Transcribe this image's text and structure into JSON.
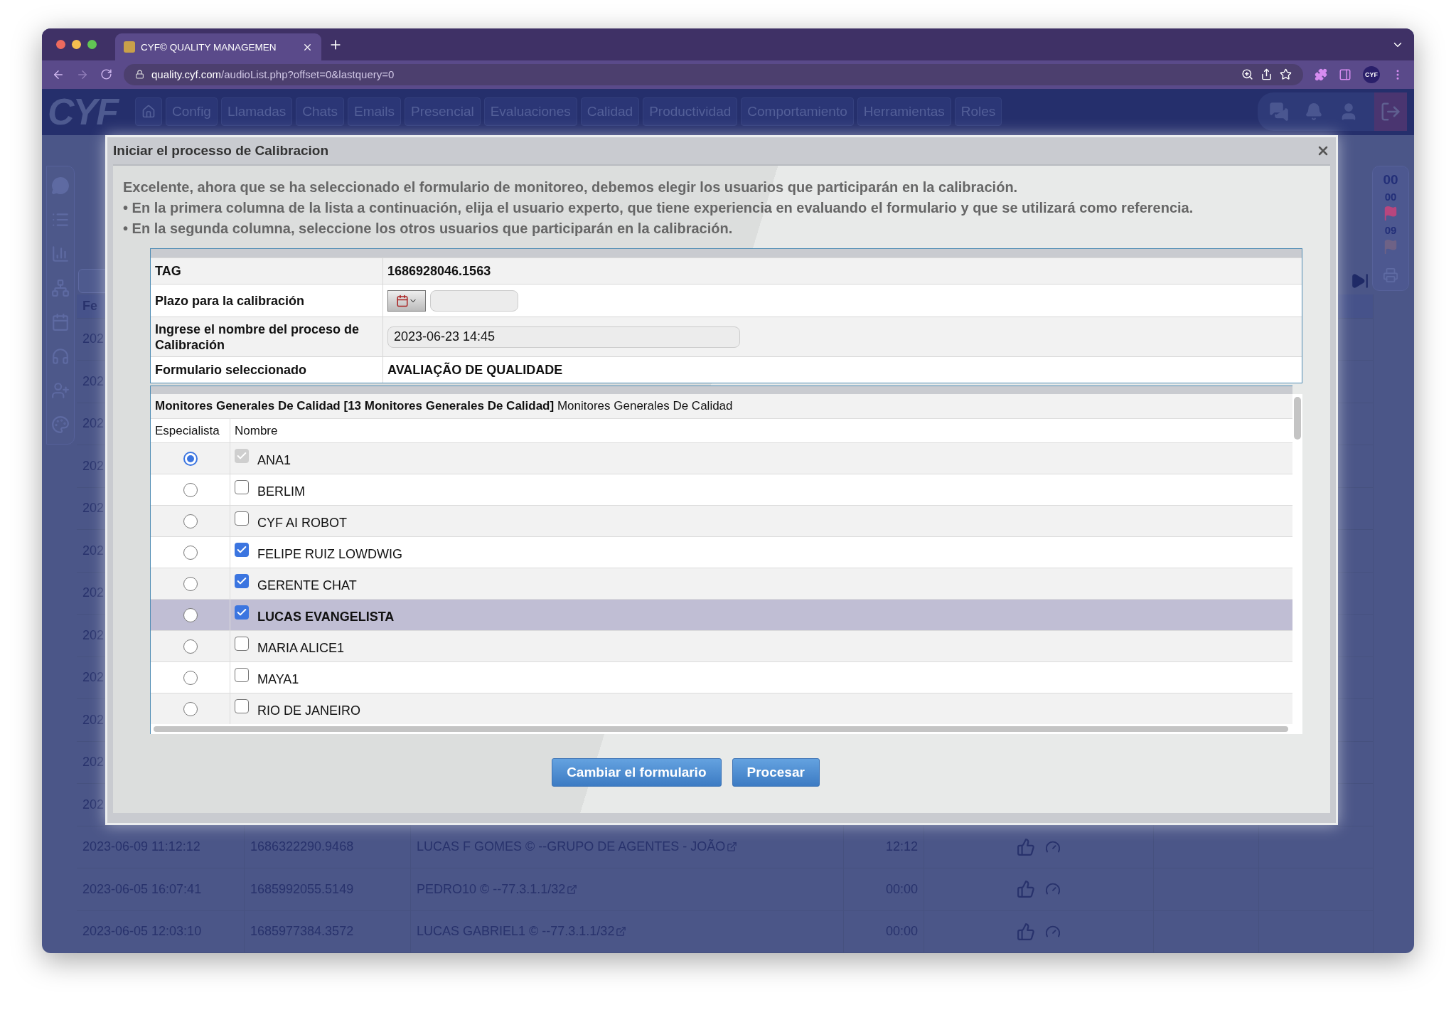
{
  "browser": {
    "tab_title": "CYF© QUALITY MANAGEMEN",
    "address": "**quality.cyf.com**/audioList.php?offset=0&lastquery=0",
    "profile": "CYF"
  },
  "nav": {
    "logo": "CYF",
    "items": [
      "Config",
      "Llamadas",
      "Chats",
      "Emails",
      "Presencial",
      "Evaluaciones",
      "Calidad",
      "Productividad",
      "Comportamiento",
      "Herramientas",
      "Roles"
    ]
  },
  "right_panel": [
    {
      "kind": "count",
      "text": "00"
    },
    {
      "kind": "count",
      "text": "00"
    },
    {
      "kind": "flag",
      "color": "#b8467e"
    },
    {
      "kind": "count",
      "text": "09"
    },
    {
      "kind": "flag",
      "color": "#6e6286"
    }
  ],
  "table": {
    "header": "Fe",
    "rows": [
      {
        "kind": "covered",
        "date": "202"
      },
      {
        "kind": "covered",
        "date": "202"
      },
      {
        "kind": "covered",
        "date": "202"
      },
      {
        "kind": "covered",
        "date": "202"
      },
      {
        "kind": "covered",
        "date": "202"
      },
      {
        "kind": "covered",
        "date": "202"
      },
      {
        "kind": "covered",
        "date": "202"
      },
      {
        "kind": "covered",
        "date": "202"
      },
      {
        "kind": "covered",
        "date": "202"
      },
      {
        "kind": "covered",
        "date": "202"
      },
      {
        "kind": "covered",
        "date": "202"
      },
      {
        "kind": "covered",
        "date": "202"
      },
      {
        "kind": "full",
        "date": "2023-06-09 11:12:12",
        "tag": "1686322290.9468",
        "agent": "LUCAS F GOMES © --GRUPO DE AGENTES - JOÃO",
        "time": "12:12"
      },
      {
        "kind": "full",
        "date": "2023-06-05 16:07:41",
        "tag": "1685992055.5149",
        "agent": "PEDRO10 © --77.3.1.1/32",
        "time": "00:00"
      },
      {
        "kind": "full",
        "date": "2023-06-05 12:03:10",
        "tag": "1685977384.3572",
        "agent": "LUCAS GABRIEL1 © --77.3.1.1/32",
        "time": "00:00"
      }
    ]
  },
  "modal": {
    "title": "Iniciar el processo de Calibracion",
    "intro": [
      "Excelente, ahora que se ha seleccionado el formulario de monitoreo, debemos elegir los usuarios que participarán en la calibración.",
      "• En la primera columna de la lista a continuación, elija el usuario experto, que tiene experiencia en evaluando el formulario y que se utilizará como referencia.",
      "• En la segunda columna, seleccione los otros usuarios que participarán en la calibración."
    ],
    "info": [
      {
        "kind": "text",
        "label": "TAG",
        "value": "1686928046.1563"
      },
      {
        "kind": "date",
        "label": "Plazo para la calibración"
      },
      {
        "kind": "input",
        "label": "Ingrese el nombre del proceso de Calibración",
        "value": "2023-06-23 14:45"
      },
      {
        "kind": "text",
        "label": "Formulario seleccionado",
        "value": "AVALIAÇÃO DE QUALIDADE"
      }
    ],
    "group_title": "**Monitores Generales De Calidad [13 Monitores Generales De Calidad]** Monitores Generales De Calidad",
    "columns": [
      "Especialista",
      "Nombre"
    ],
    "users": [
      {
        "name": "ANA1",
        "specialist": true,
        "checked": true,
        "disabled": true,
        "highlighted": false
      },
      {
        "name": "BERLIM",
        "specialist": false,
        "checked": false,
        "disabled": false,
        "highlighted": false
      },
      {
        "name": "CYF AI ROBOT",
        "specialist": false,
        "checked": false,
        "disabled": false,
        "highlighted": false
      },
      {
        "name": "FELIPE RUIZ LOWDWIG",
        "specialist": false,
        "checked": true,
        "disabled": false,
        "highlighted": false
      },
      {
        "name": "GERENTE CHAT",
        "specialist": false,
        "checked": true,
        "disabled": false,
        "highlighted": false
      },
      {
        "name": "LUCAS EVANGELISTA",
        "specialist": false,
        "checked": true,
        "disabled": false,
        "highlighted": true
      },
      {
        "name": "MARIA ALICE1",
        "specialist": false,
        "checked": false,
        "disabled": false,
        "highlighted": false
      },
      {
        "name": "MAYA1",
        "specialist": false,
        "checked": false,
        "disabled": false,
        "highlighted": false
      },
      {
        "name": "RIO DE JANEIRO",
        "specialist": false,
        "checked": false,
        "disabled": false,
        "highlighted": false
      }
    ],
    "buttons": [
      "Cambiar el formulario",
      "Procesar"
    ]
  }
}
